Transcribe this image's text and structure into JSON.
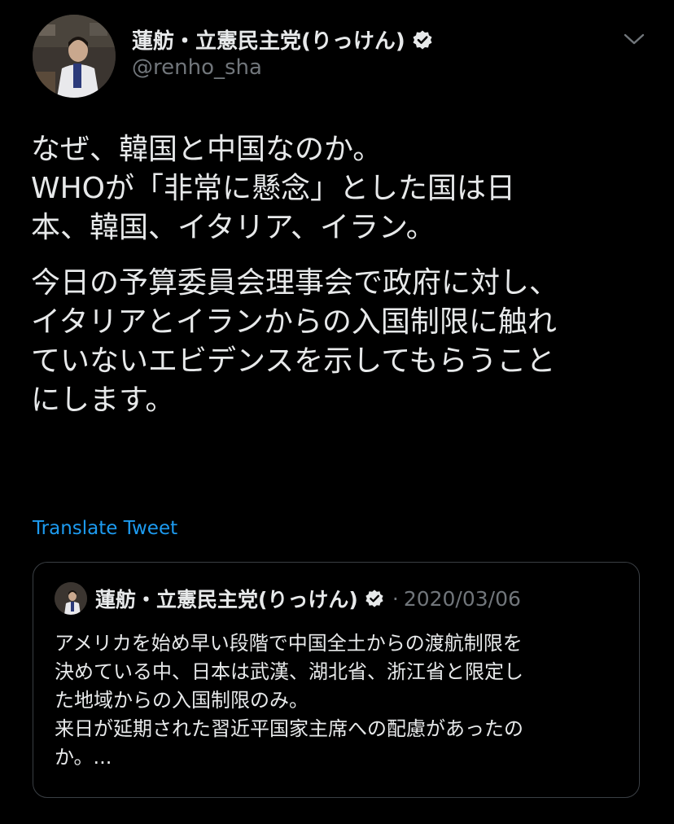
{
  "author": {
    "display_name": "蓮舫・立憲民主党(りっけん)",
    "handle": "@renho_sha"
  },
  "tweet": {
    "paragraphs": [
      "なぜ、韓国と中国なのか。\nWHOが「非常に懸念」とした国は日\n本、韓国、イタリア、イラン。",
      "今日の予算委員会理事会で政府に対し、\nイタリアとイランからの入国制限に触れ\nていないエビデンスを示してもらうこと\nにします。"
    ],
    "translate_label": "Translate Tweet"
  },
  "quoted_tweet": {
    "display_name": "蓮舫・立憲民主党(りっけん)",
    "separator": "·",
    "date": "2020/03/06",
    "text": "アメリカを始め早い段階で中国全土からの渡航制限を\n決めている中、日本は武漢、湖北省、浙江省と限定し\nた地域からの入国制限のみ。\n来日が延期された習近平国家主席への配慮があったの\nか。..."
  },
  "colors": {
    "background": "#000000",
    "text": "#e7e9ea",
    "secondary_text": "#71767b",
    "link": "#1d9bf0",
    "border": "#3a3f44"
  },
  "icons": {
    "verified": "verified-badge-icon",
    "more": "chevron-down-icon"
  }
}
